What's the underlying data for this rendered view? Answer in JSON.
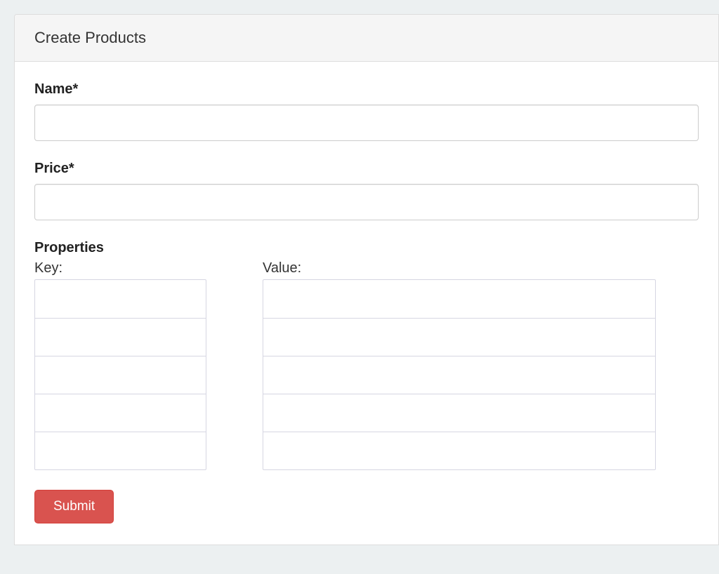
{
  "panel": {
    "title": "Create Products"
  },
  "form": {
    "name": {
      "label": "Name*",
      "value": ""
    },
    "price": {
      "label": "Price*",
      "value": ""
    },
    "properties": {
      "label": "Properties",
      "key_label": "Key:",
      "value_label": "Value:",
      "rows": [
        {
          "key": "",
          "value": ""
        },
        {
          "key": "",
          "value": ""
        },
        {
          "key": "",
          "value": ""
        },
        {
          "key": "",
          "value": ""
        },
        {
          "key": "",
          "value": ""
        }
      ]
    },
    "submit_label": "Submit"
  }
}
